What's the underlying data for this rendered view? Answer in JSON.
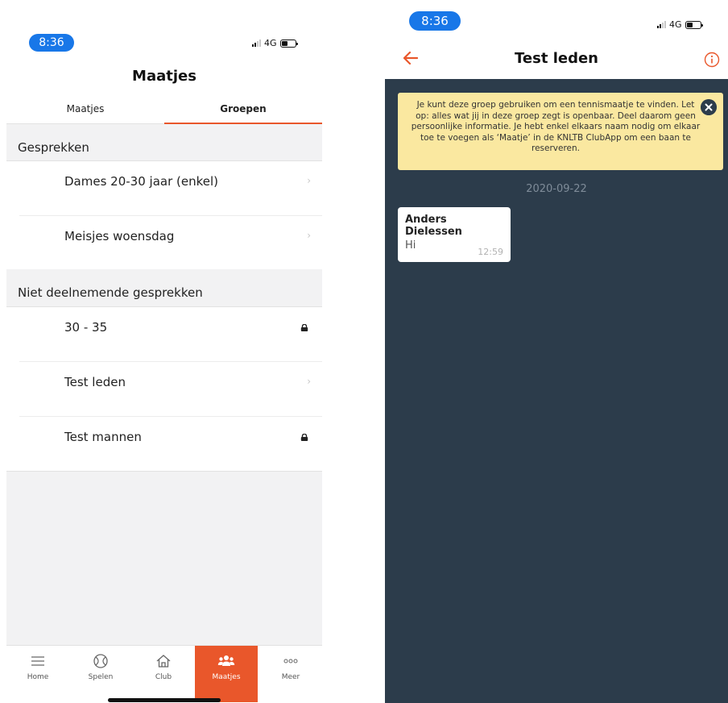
{
  "left_screen": {
    "status": {
      "time": "8:36",
      "network": "4G"
    },
    "title": "Maatjes",
    "tabs": [
      {
        "label": "Maatjes",
        "active": false
      },
      {
        "label": "Groepen",
        "active": true
      }
    ],
    "sections": [
      {
        "header": "Gesprekken",
        "items": [
          {
            "label": "Dames 20-30 jaar (enkel)",
            "icon": "chevron-right-icon"
          },
          {
            "label": "Meisjes woensdag",
            "icon": "chevron-right-icon"
          }
        ]
      },
      {
        "header": "Niet deelnemende gesprekken",
        "items": [
          {
            "label": "30 - 35",
            "icon": "lock-icon"
          },
          {
            "label": "Test leden",
            "icon": "chevron-right-icon"
          },
          {
            "label": "Test mannen",
            "icon": "lock-icon"
          }
        ]
      }
    ],
    "tabbar": [
      {
        "label": "Home",
        "icon": "menu-lines-icon",
        "active": false
      },
      {
        "label": "Spelen",
        "icon": "tennis-ball-icon",
        "active": false
      },
      {
        "label": "Club",
        "icon": "house-icon",
        "active": false
      },
      {
        "label": "Maatjes",
        "icon": "people-group-icon",
        "active": true
      },
      {
        "label": "Meer",
        "icon": "more-dots-icon",
        "active": false
      }
    ]
  },
  "right_screen": {
    "status": {
      "time": "8:36",
      "network": "4G"
    },
    "title": "Test leden",
    "notice": "Je kunt deze groep gebruiken om een tennismaatje te vinden. Let op: alles wat jij in deze groep zegt is openbaar. Deel daarom geen persoonlijke informatie. Je hebt enkel elkaars naam nodig om elkaar toe te voegen als ‘Maatje’ in de KNLTB ClubApp om een baan te reserveren.",
    "date": "2020-09-22",
    "messages": [
      {
        "sender": "Anders Dielessen",
        "text": "Hi",
        "time": "12:59"
      }
    ]
  },
  "colors": {
    "accent": "#e9572b",
    "time_pill": "#1877e8",
    "chat_background": "#2c3c4b",
    "notice_background": "#fae8a0",
    "section_background": "#f2f2f3"
  }
}
